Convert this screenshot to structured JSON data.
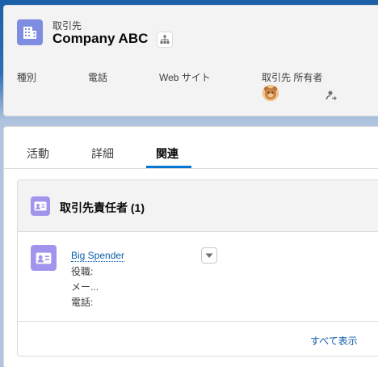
{
  "header": {
    "object_type": "取引先",
    "record_name": "Company ABC",
    "icon": "building-icon",
    "hierarchy_icon": "hierarchy-icon",
    "fields": [
      {
        "label": "種別"
      },
      {
        "label": "電話"
      },
      {
        "label": "Web サイト"
      },
      {
        "label": "取引先 所有者"
      }
    ],
    "owner_avatar_icon": "user-avatar",
    "change_owner_icon": "change-owner-icon"
  },
  "tabs": [
    {
      "label": "活動",
      "active": false
    },
    {
      "label": "詳細",
      "active": false
    },
    {
      "label": "関連",
      "active": true
    }
  ],
  "related_list": {
    "title": "取引先責任者 (1)",
    "icon": "contact-icon",
    "records": [
      {
        "name": "Big Spender",
        "fields": [
          "役職:",
          "メー...",
          "電話:"
        ],
        "menu_icon": "chevron-down-icon"
      }
    ],
    "view_all": "すべて表示"
  },
  "colors": {
    "account_icon": "#7f8de1",
    "contact_icon": "#a094ed",
    "link": "#0b5cab",
    "active_tab": "#0176d3",
    "header_bg": "#1b5fa8"
  }
}
